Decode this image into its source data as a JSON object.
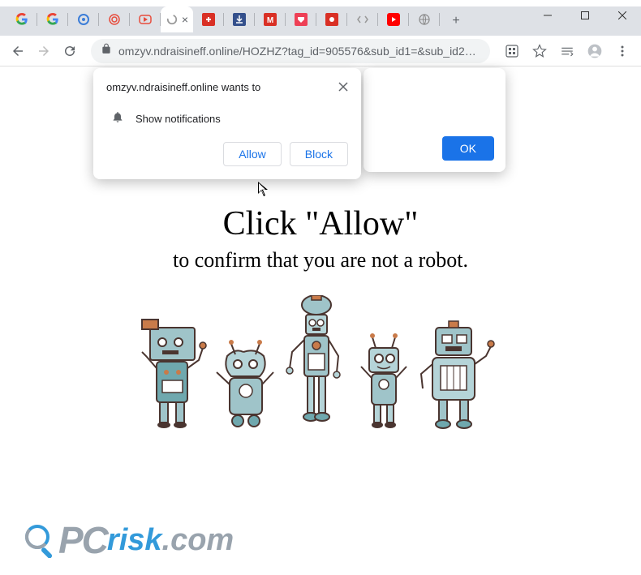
{
  "window": {
    "minimize": "–",
    "maximize": "□",
    "close": "×"
  },
  "tabs": {
    "active_close": "×",
    "new_tab": "+"
  },
  "omnibox": {
    "url": "omzyv.ndraisineff.online/HOZHZ?tag_id=905576&sub_id1=&sub_id2…"
  },
  "permission": {
    "title": "omzyv.ndraisineff.online wants to",
    "label": "Show notifications",
    "allow": "Allow",
    "block": "Block",
    "close": "×"
  },
  "ok_dialog": {
    "ok": "OK"
  },
  "content": {
    "headline": "Click \"Allow\"",
    "subline": "to confirm that you are not a robot."
  },
  "watermark": {
    "pc": "PC",
    "risk": "risk",
    "com": ".com"
  }
}
